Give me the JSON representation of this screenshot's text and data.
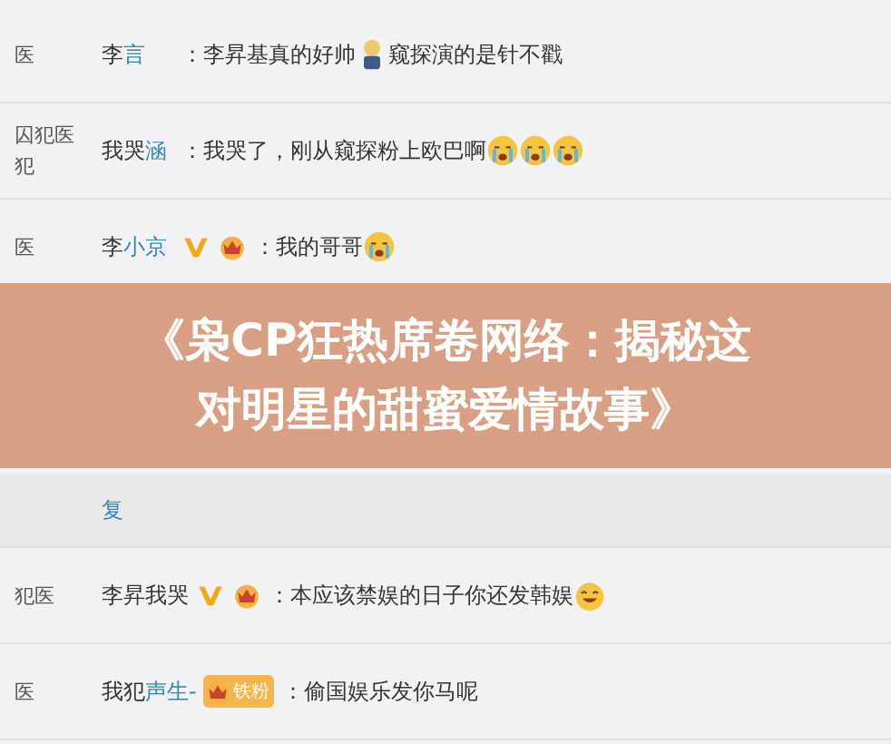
{
  "comments": [
    {
      "side": [
        "医"
      ],
      "author": [
        {
          "kind": "plain",
          "text": "李"
        },
        {
          "kind": "link",
          "text": "言"
        }
      ],
      "body": [
        {
          "kind": "text",
          "text": "：李昇基真的好帅"
        },
        {
          "kind": "figure"
        },
        {
          "kind": "text",
          "text": "窥探演的是针不戳"
        }
      ]
    },
    {
      "side": [
        "囚犯医",
        "犯"
      ],
      "author": [
        {
          "kind": "plain",
          "text": "我哭"
        },
        {
          "kind": "link",
          "text": "涵"
        }
      ],
      "body": [
        {
          "kind": "text",
          "text": "：我哭了，刚从窥探粉上欧巴啊"
        },
        {
          "kind": "cry"
        },
        {
          "kind": "cry"
        },
        {
          "kind": "cry"
        }
      ]
    },
    {
      "side": [
        "医"
      ],
      "author": [
        {
          "kind": "plain",
          "text": "李"
        },
        {
          "kind": "link",
          "text": "小京"
        }
      ],
      "badges": [
        {
          "kind": "vip"
        },
        {
          "kind": "crown"
        }
      ],
      "body": [
        {
          "kind": "text",
          "text": "：我的哥哥"
        },
        {
          "kind": "cry"
        }
      ]
    },
    {
      "author": [
        {
          "kind": "link",
          "text": "复"
        }
      ]
    },
    {
      "side": [
        "犯医"
      ],
      "author": [
        {
          "kind": "plain",
          "text": "李昇"
        },
        {
          "kind": "plain",
          "text": "我哭"
        }
      ],
      "badges": [
        {
          "kind": "vip"
        },
        {
          "kind": "crown"
        }
      ],
      "body": [
        {
          "kind": "text",
          "text": "：本应该禁娱的日子你还发韩娱"
        },
        {
          "kind": "grin"
        }
      ]
    },
    {
      "side": [
        "医"
      ],
      "author": [
        {
          "kind": "plain",
          "text": "我犯"
        },
        {
          "kind": "link",
          "text": "声生-"
        }
      ],
      "badges": [
        {
          "kind": "crown",
          "label": "铁粉"
        }
      ],
      "body": [
        {
          "kind": "text",
          "text": "：偷国娱乐发你马呢"
        }
      ]
    }
  ],
  "banner": {
    "title_lines": [
      "《枭CP狂热席卷网络：揭秘这",
      "对明星的甜蜜爱情故事》"
    ]
  }
}
